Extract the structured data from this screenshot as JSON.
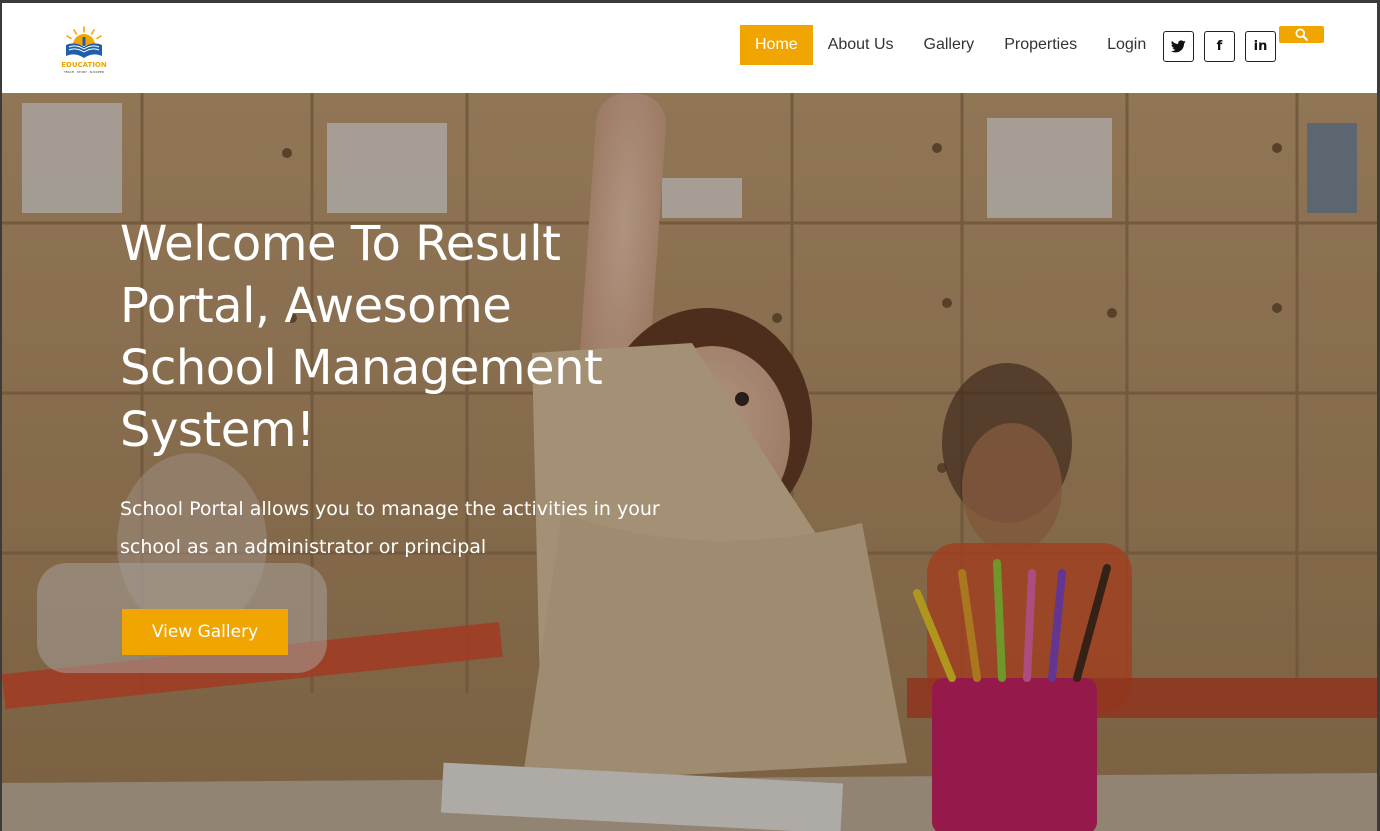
{
  "logo": {
    "text": "EDUCATION",
    "subtext": "TEACH · STUDY · SUCCEED"
  },
  "nav": {
    "items": [
      {
        "label": "Home",
        "active": true
      },
      {
        "label": "About Us",
        "active": false
      },
      {
        "label": "Gallery",
        "active": false
      },
      {
        "label": "Properties",
        "active": false
      },
      {
        "label": "Login",
        "active": false
      }
    ]
  },
  "socials": {
    "twitter": "twitter-icon",
    "facebook": "f",
    "linkedin": "in"
  },
  "search": {
    "icon": "search-icon"
  },
  "hero": {
    "title": "Welcome To Result Portal, Awesome School Management System!",
    "subtitle": "School Portal allows you to manage the activities in your school as an administrator or principal",
    "button_label": "View Gallery"
  },
  "colors": {
    "accent": "#f0a500",
    "text_dark": "#333333",
    "hero_text": "#ffffff"
  }
}
